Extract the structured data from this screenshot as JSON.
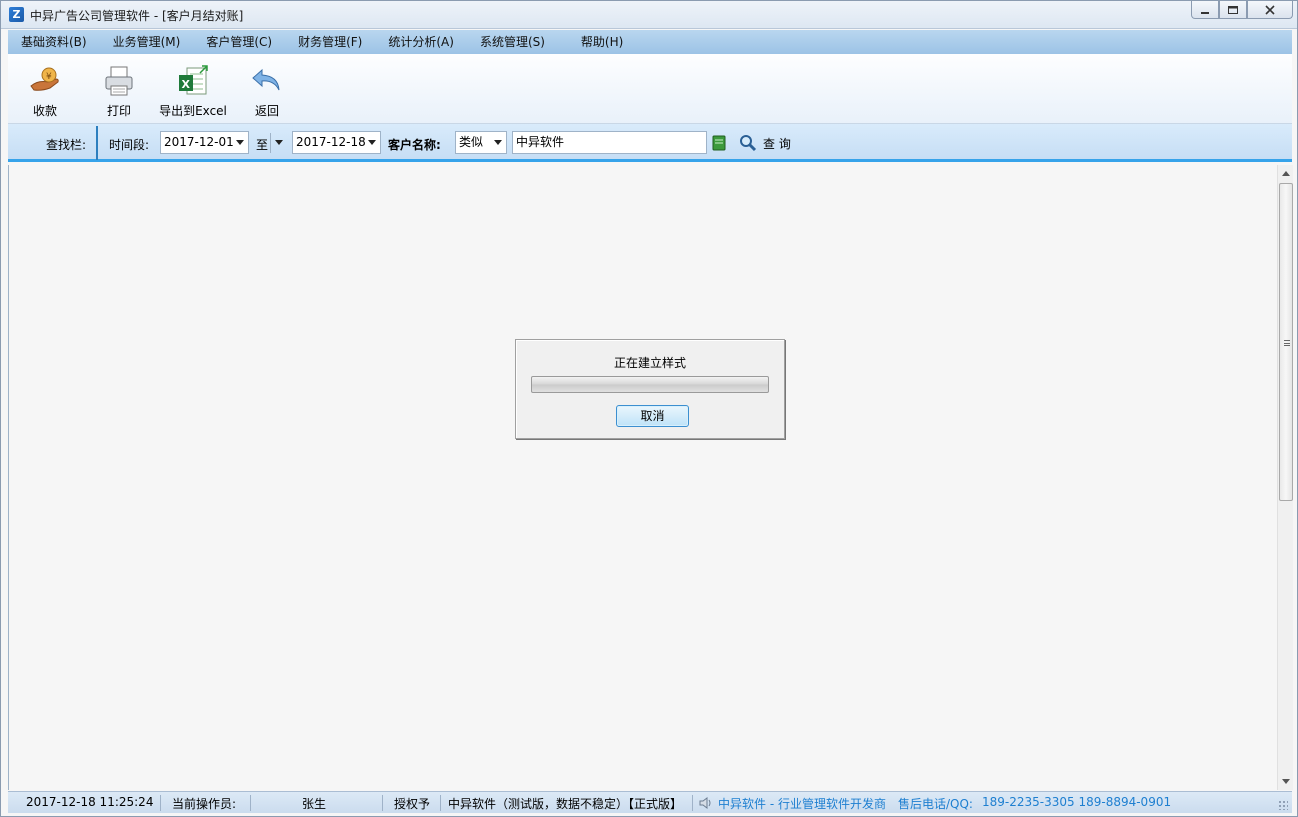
{
  "window": {
    "title": "中异广告公司管理软件 - [客户月结对账]",
    "icon_name": "app-logo-icon",
    "controls": [
      "minimize-icon",
      "maximize-icon",
      "close-icon"
    ]
  },
  "menu": [
    {
      "label": "基础资料(B)"
    },
    {
      "label": "业务管理(M)"
    },
    {
      "label": "客户管理(C)"
    },
    {
      "label": "财务管理(F)"
    },
    {
      "label": "统计分析(A)"
    },
    {
      "label": "系统管理(S)"
    },
    {
      "label": "帮助(H)"
    }
  ],
  "toolbar": [
    {
      "label": "收款",
      "icon": "money-hand-icon"
    },
    {
      "label": "打印",
      "icon": "printer-icon"
    },
    {
      "label": "导出到Excel",
      "icon": "excel-export-icon"
    },
    {
      "label": "返回",
      "icon": "back-arrow-icon"
    }
  ],
  "search": {
    "bar_label": "查找栏:",
    "period_label": "时间段:",
    "date_from": "2017-12-01",
    "to_label": "至",
    "date_to": "2017-12-18",
    "customer_label": "客户名称:",
    "match_mode": "类似",
    "customer_value": "中异软件",
    "query_label": "查 询"
  },
  "dialog": {
    "message": "正在建立样式",
    "progress": 0,
    "cancel_label": "取消"
  },
  "status": {
    "datetime": "2017-12-18 11:25:24",
    "operator_label": "当前操作员:",
    "operator_name": "张生",
    "license_label": "授权予",
    "license_info": "中异软件（测试版，数据不稳定）【正式版】",
    "vendor": "中异软件 - 行业管理软件开发商",
    "support_label": "售后电话/QQ:",
    "support_phones": "189-2235-3305  189-8894-0901"
  },
  "colors": {
    "accent": "#36a3ea",
    "menubar": "#9cc3e6",
    "status_link": "#1e7fd0"
  }
}
